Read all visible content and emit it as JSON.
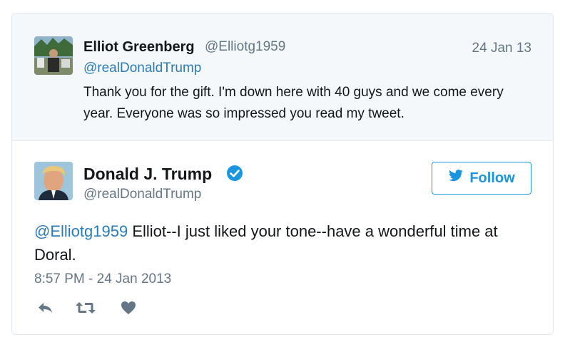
{
  "quoted_tweet": {
    "author_name": "Elliot Greenberg",
    "author_handle": "@Elliotg1959",
    "date": "24 Jan 13",
    "mention": "@realDonaldTrump",
    "text": "Thank you for the gift. I'm down here with 40 guys and we come every year. Everyone was so impressed you read my tweet."
  },
  "main_tweet": {
    "author_name": "Donald J. Trump",
    "author_handle": "@realDonaldTrump",
    "follow_label": "Follow",
    "mention": "@Elliotg1959",
    "text": " Elliot--I just liked your tone--have a wonderful time at Doral.",
    "timestamp": "8:57 PM - 24 Jan 2013"
  },
  "icons": {
    "verified": "verified-badge-icon",
    "follow": "twitter-bird-icon",
    "reply": "reply-icon",
    "retweet": "retweet-icon",
    "like": "heart-icon"
  },
  "colors": {
    "link": "#2b7bb9",
    "brand": "#1b95e0",
    "muted": "#657786",
    "quoted_bg": "#f5f8fa"
  }
}
